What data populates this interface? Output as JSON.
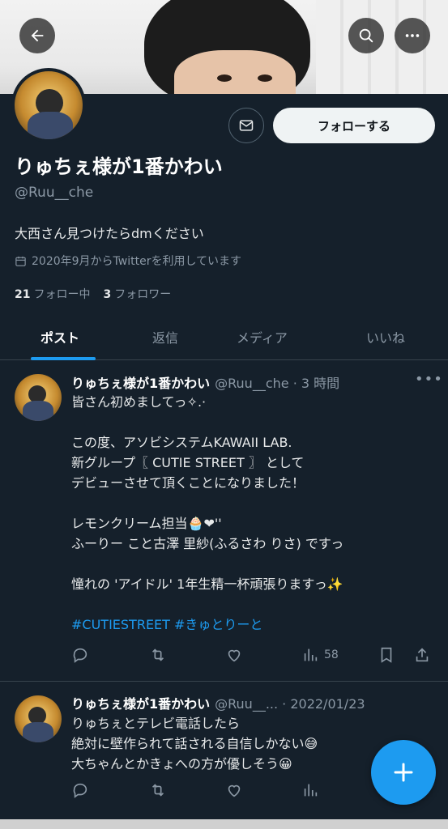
{
  "profile": {
    "name": "りゅちぇ様が1番かわい",
    "handle": "@Ruu__che",
    "bio": "大西さん見つけたらdmください",
    "joined": "2020年9月からTwitterを利用しています",
    "following_count": "21",
    "following_label": "フォロー中",
    "followers_count": "3",
    "followers_label": "フォロワー",
    "follow_button": "フォローする"
  },
  "tabs": [
    "ポスト",
    "返信",
    "メディア",
    "いいね"
  ],
  "posts": [
    {
      "name": "りゅちぇ様が1番かわい",
      "meta": "@Ruu__che · 3 時間",
      "lines": [
        "皆さん初めましてっ✧.·",
        "",
        "この度、アソビシステムKAWAII LAB.",
        "新グループ〖 CUTIE STREET 〗 として",
        "デビューさせて頂くことになりました！",
        "",
        "レモンクリーム担当🧁❤''",
        "ふーりー こと古澤 里紗(ふるさわ りさ) ですっ",
        "",
        "憧れの 'アイドル' 1年生精一杯頑張りますっ✨",
        ""
      ],
      "hashtags": "#CUTIESTREET #きゅとりーと",
      "views": "58"
    },
    {
      "name": "りゅちぇ様が1番かわい",
      "meta": "@Ruu__... · 2022/01/23",
      "lines": [
        "りゅちぇとテレビ電話したら",
        "絶対に壁作られて話される自信しかない😅",
        "大ちゃんとかきょへの方が優しそう😀"
      ]
    }
  ],
  "icons": {
    "back": "arrow-left-icon",
    "search": "search-icon",
    "more": "more-horizontal-icon",
    "mail": "mail-icon",
    "calendar": "calendar-icon",
    "reply": "reply-icon",
    "retweet": "retweet-icon",
    "like": "heart-icon",
    "views": "views-icon",
    "bookmark": "bookmark-icon",
    "share": "share-icon",
    "compose": "plus-icon"
  },
  "colors": {
    "background": "#15202b",
    "accent": "#1d9bf0",
    "muted": "#8b98a5"
  }
}
